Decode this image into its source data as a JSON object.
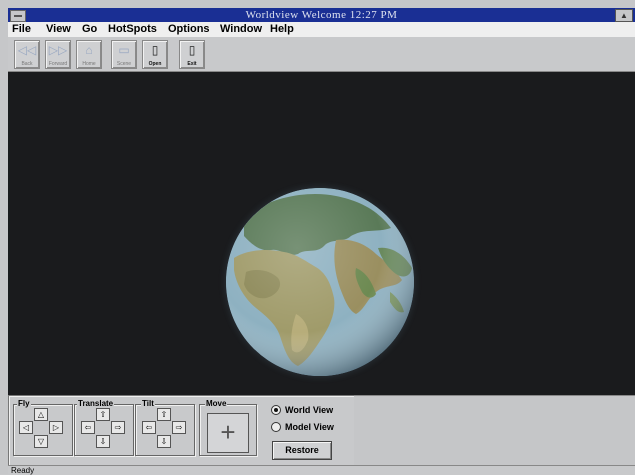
{
  "titlebar": {
    "title": "Worldview  Welcome  12:27 PM"
  },
  "menu": [
    "File",
    "View",
    "Go",
    "HotSpots",
    "Options",
    "Window",
    "Help"
  ],
  "toolbar": [
    {
      "label": "Back",
      "icon": "back-arrows-icon",
      "enabled": false
    },
    {
      "label": "Forward",
      "icon": "forward-arrows-icon",
      "enabled": false
    },
    {
      "label": "Home",
      "icon": "home-icon",
      "enabled": false
    },
    {
      "label": "Scene",
      "icon": "scene-icon",
      "enabled": false
    },
    {
      "label": "Open",
      "icon": "open-icon",
      "enabled": true
    },
    {
      "label": "Exit",
      "icon": "exit-icon",
      "enabled": true
    }
  ],
  "controls": {
    "fly": "Fly",
    "translate": "Translate",
    "tilt": "Tilt",
    "move": "Move",
    "world_view": "World View",
    "model_view": "Model View",
    "selected_view": "World View",
    "restore": "Restore"
  },
  "status": "Ready"
}
